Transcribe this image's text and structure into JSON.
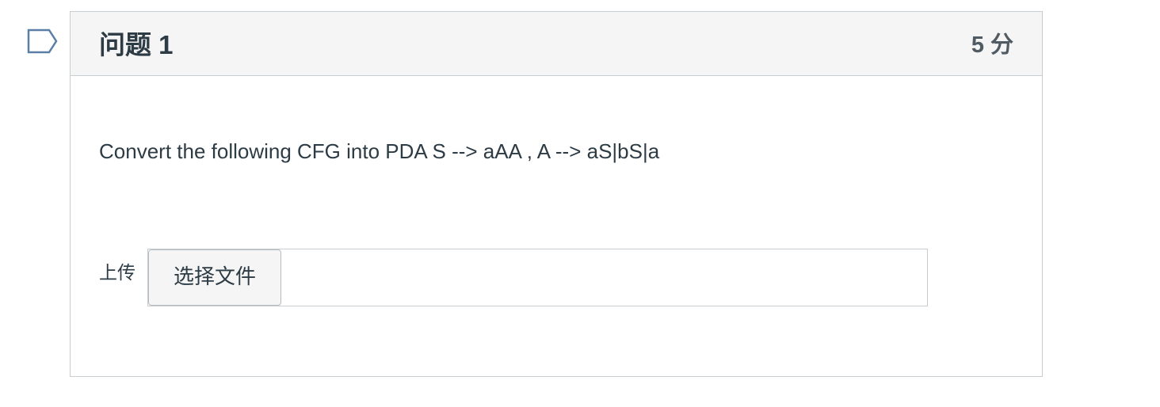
{
  "question": {
    "title": "问题 1",
    "points": "5 分",
    "text": "Convert the following CFG into PDA S --> aAA , A --> aS|bS|a",
    "upload_label": "上传",
    "file_button_label": "选择文件",
    "file_name": ""
  },
  "icons": {
    "flag": "flag-outline-icon"
  },
  "colors": {
    "header_bg": "#f5f5f5",
    "border": "#c7cdd1",
    "text": "#2d3b45",
    "flag_stroke": "#5b7fa6"
  }
}
